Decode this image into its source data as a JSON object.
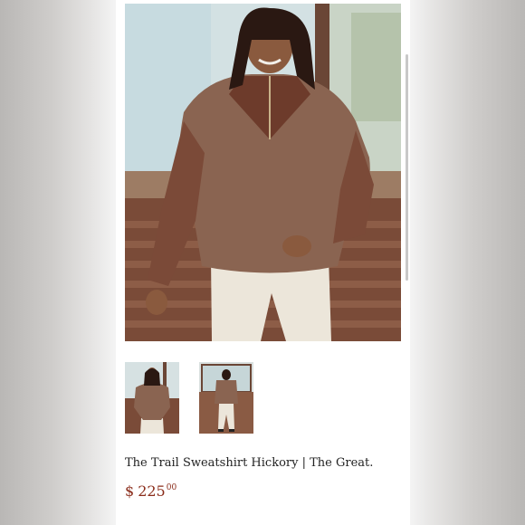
{
  "product": {
    "title": "The Trail Sweatshirt Hickory | The Great.",
    "price_currency": "$",
    "price_whole": "225",
    "price_cents": "00"
  },
  "gallery": {
    "main_image": "model-wearing-brown-quarter-zip-sweatshirt",
    "thumbnails": [
      {
        "name": "thumbnail-front-view"
      },
      {
        "name": "thumbnail-back-view"
      }
    ]
  },
  "colors": {
    "price": "#8a2c1a",
    "sweatshirt": "#7b4a38",
    "trousers": "#ece6da"
  }
}
